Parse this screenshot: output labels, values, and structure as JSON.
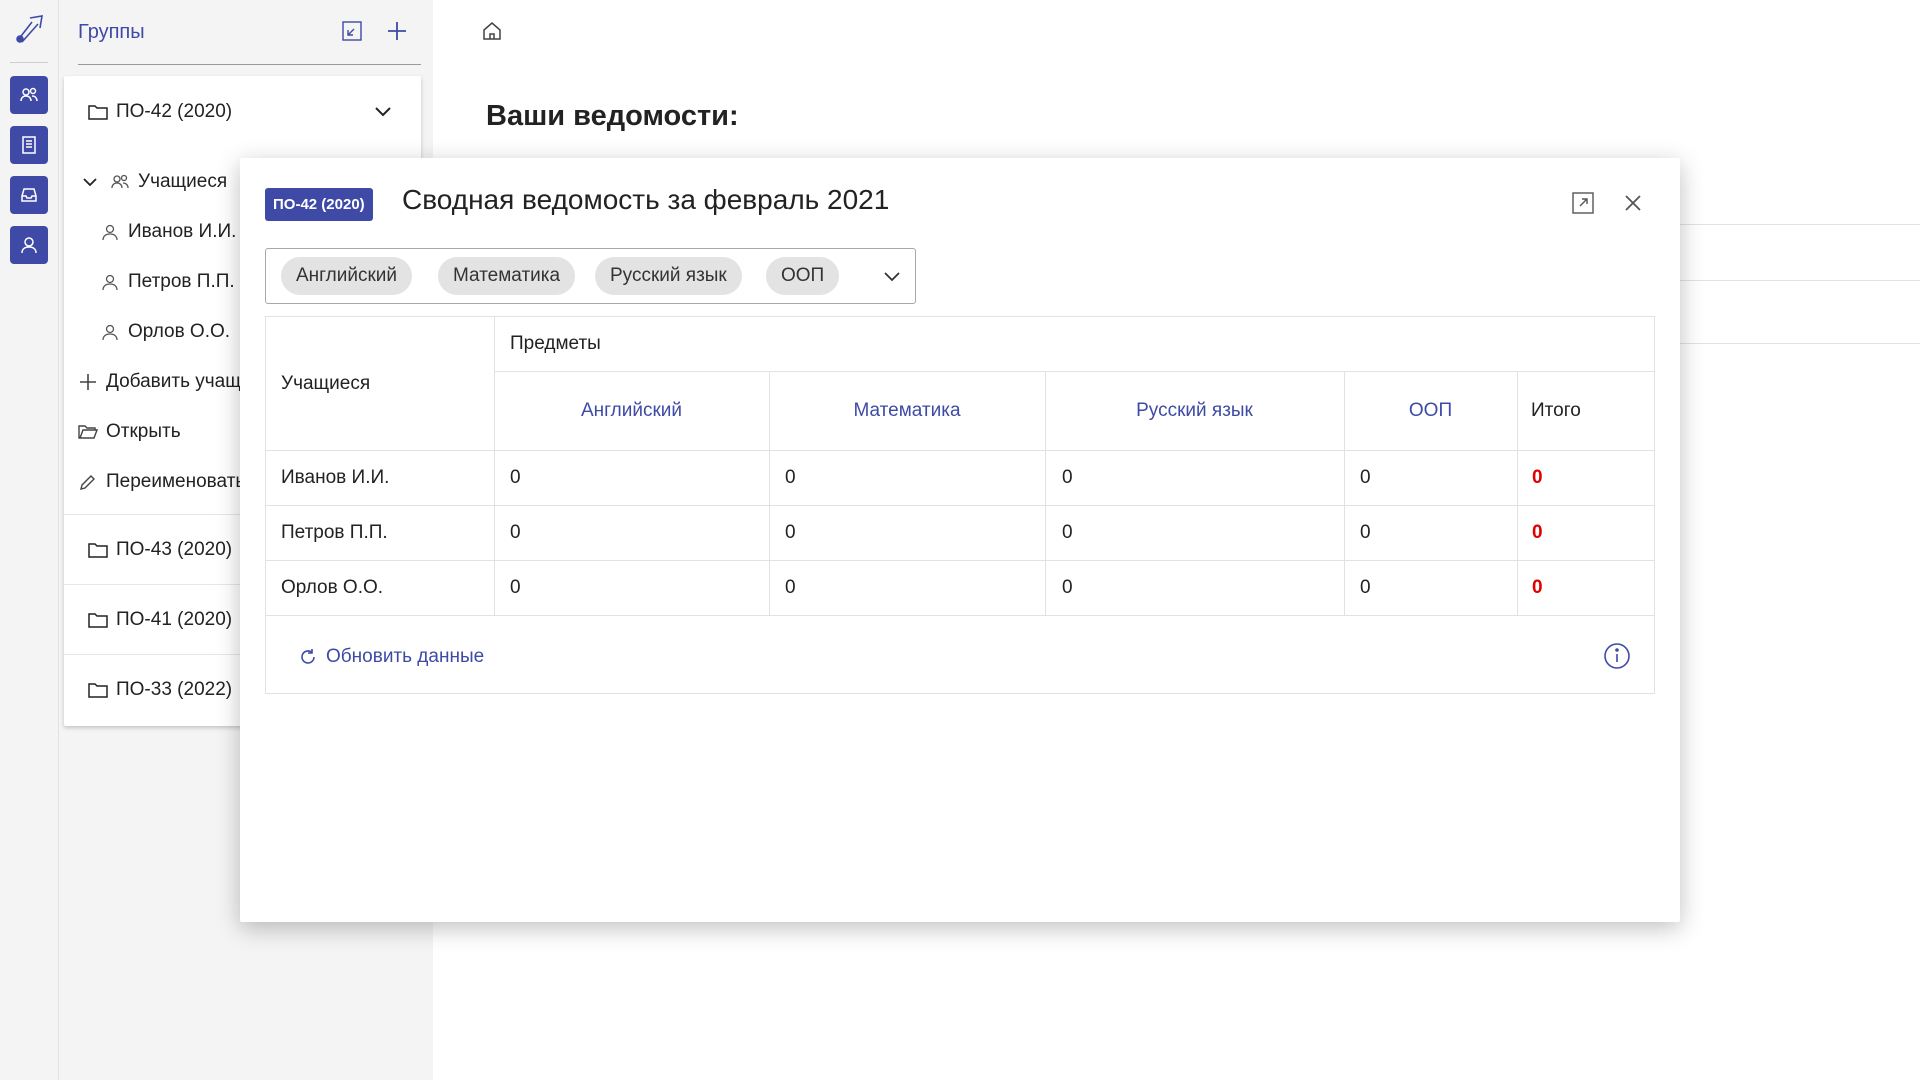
{
  "rail": {
    "icons": [
      "app-logo-icon",
      "groups-icon",
      "document-icon",
      "inbox-icon",
      "person-icon"
    ]
  },
  "sidebar": {
    "title": "Группы",
    "expanded_group": "ПО-42 (2020)",
    "students_label": "Учащиеся",
    "students": [
      "Иванов И.И.",
      "Петров П.П.",
      "Орлов О.О."
    ],
    "add_student": "Добавить учащегося",
    "open": "Открыть",
    "rename": "Переименовать",
    "other_groups": [
      "ПО-43 (2020)",
      "ПО-41 (2020)",
      "ПО-33 (2022)"
    ]
  },
  "main": {
    "title": "Ваши ведомости:"
  },
  "modal": {
    "badge": "ПО-42 (2020)",
    "title": "Сводная ведомость за февраль 2021",
    "chips": [
      "Английский",
      "Математика",
      "Русский язык",
      "ООП"
    ],
    "table": {
      "students_header": "Учащиеся",
      "subjects_header": "Предметы",
      "columns": [
        "Английский",
        "Математика",
        "Русский язык",
        "ООП"
      ],
      "total_header": "Итого",
      "rows": [
        {
          "name": "Иванов И.И.",
          "values": [
            "0",
            "0",
            "0",
            "0"
          ],
          "total": "0"
        },
        {
          "name": "Петров П.П.",
          "values": [
            "0",
            "0",
            "0",
            "0"
          ],
          "total": "0"
        },
        {
          "name": "Орлов О.О.",
          "values": [
            "0",
            "0",
            "0",
            "0"
          ],
          "total": "0"
        }
      ]
    },
    "refresh": "Обновить данные"
  },
  "colors": {
    "accent": "#3e4aa6",
    "total_red": "#e00000"
  }
}
